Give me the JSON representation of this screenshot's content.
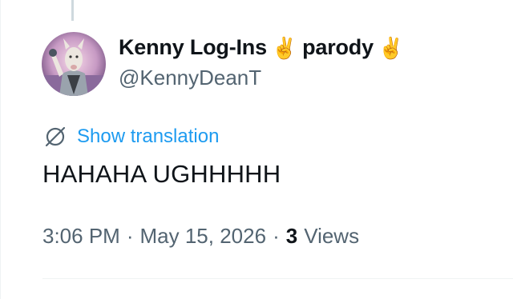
{
  "tweet": {
    "display_name": "Kenny Log-Ins",
    "name_emoji_1": "✌️",
    "name_suffix": "parody",
    "name_emoji_2": "✌️",
    "handle": "@KennyDeanT",
    "translate_label": "Show translation",
    "text": "HAHAHA UGHHHHH",
    "time": "3:06 PM",
    "date": "May 15, 2026",
    "separator": "·",
    "views_count": "3",
    "views_label": "Views"
  },
  "colors": {
    "link": "#1d9bf0",
    "secondary_text": "#536471",
    "primary_text": "#0f1419"
  }
}
